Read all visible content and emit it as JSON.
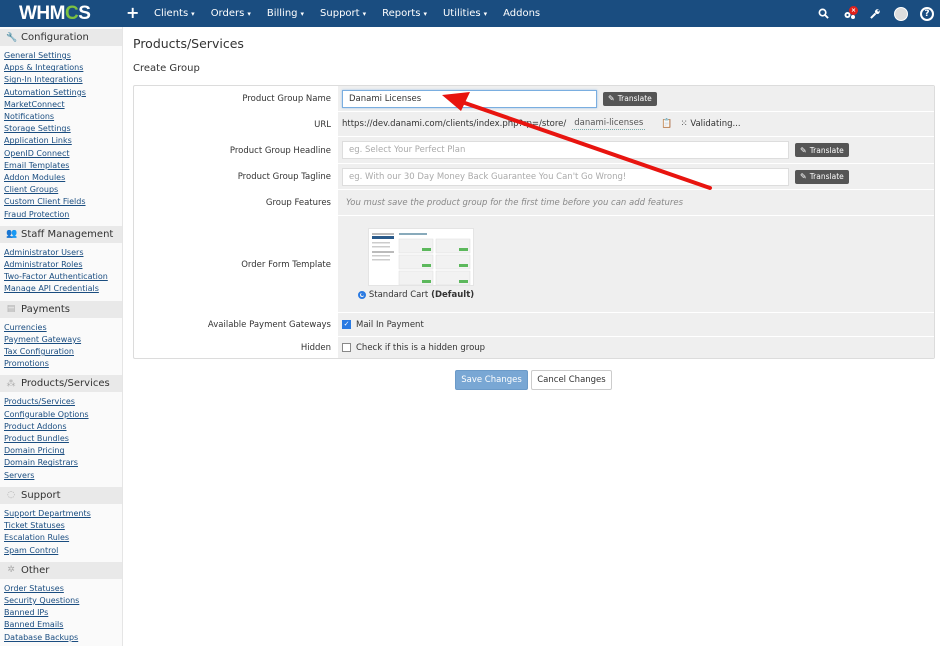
{
  "topnav": {
    "logo_prefix": "WHM",
    "logo_gear": "C",
    "logo_suffix": "S",
    "add_icon": "+",
    "menu": [
      {
        "label": "Clients"
      },
      {
        "label": "Orders"
      },
      {
        "label": "Billing"
      },
      {
        "label": "Support"
      },
      {
        "label": "Reports"
      },
      {
        "label": "Utilities"
      },
      {
        "label": "Addons"
      }
    ],
    "caret": "▾",
    "icons": {
      "search": "search-icon",
      "system": "gears-icon",
      "system_badge": "×",
      "setup": "wrench-icon",
      "user": "avatar",
      "help": "?"
    }
  },
  "sidebar": {
    "sections": [
      {
        "title": "Configuration",
        "icon": "wrench-icon",
        "glyph": "🔧",
        "items": [
          "General Settings",
          "Apps & Integrations",
          "Sign-In Integrations",
          "Automation Settings",
          "MarketConnect",
          "Notifications",
          "Storage Settings",
          "Application Links",
          "OpenID Connect",
          "Email Templates",
          "Addon Modules",
          "Client Groups",
          "Custom Client Fields",
          "Fraud Protection"
        ]
      },
      {
        "title": "Staff Management",
        "icon": "users-icon",
        "glyph": "👥",
        "items": [
          "Administrator Users",
          "Administrator Roles",
          "Two-Factor Authentication",
          "Manage API Credentials"
        ]
      },
      {
        "title": "Payments",
        "icon": "money-icon",
        "glyph": "▤",
        "items": [
          "Currencies",
          "Payment Gateways",
          "Tax Configuration",
          "Promotions"
        ]
      },
      {
        "title": "Products/Services",
        "icon": "cubes-icon",
        "glyph": "⁂",
        "items": [
          "Products/Services",
          "Configurable Options",
          "Product Addons",
          "Product Bundles",
          "Domain Pricing",
          "Domain Registrars",
          "Servers"
        ]
      },
      {
        "title": "Support",
        "icon": "support-icon",
        "glyph": "◌",
        "items": [
          "Support Departments",
          "Ticket Statuses",
          "Escalation Rules",
          "Spam Control"
        ]
      },
      {
        "title": "Other",
        "icon": "cog-icon",
        "glyph": "✲",
        "items": [
          "Order Statuses",
          "Security Questions",
          "Banned IPs",
          "Banned Emails",
          "Database Backups"
        ]
      }
    ]
  },
  "main": {
    "title": "Products/Services",
    "subtitle": "Create Group",
    "form": {
      "name_label": "Product Group Name",
      "name_value": "Danami Licenses",
      "translate_label": "Translate",
      "url_label": "URL",
      "url_base": "https://dev.danami.com/clients/index.php?rp=/store/",
      "url_slug": "danami-licenses",
      "validating": "Validating...",
      "headline_label": "Product Group Headline",
      "headline_placeholder": "eg. Select Your Perfect Plan",
      "tagline_label": "Product Group Tagline",
      "tagline_placeholder": "eg. With our 30 Day Money Back Guarantee You Can't Go Wrong!",
      "features_label": "Group Features",
      "features_note": "You must save the product group for the first time before you can add features",
      "template_label": "Order Form Template",
      "template_name": "Standard Cart",
      "template_default": "(Default)",
      "gateways_label": "Available Payment Gateways",
      "gateway_option": "Mail In Payment",
      "gateway_checked": true,
      "hidden_label": "Hidden",
      "hidden_option": "Check if this is a hidden group",
      "hidden_checked": false
    },
    "save_label": "Save Changes",
    "cancel_label": "Cancel Changes"
  },
  "annotation": {
    "color": "#e8140f"
  }
}
